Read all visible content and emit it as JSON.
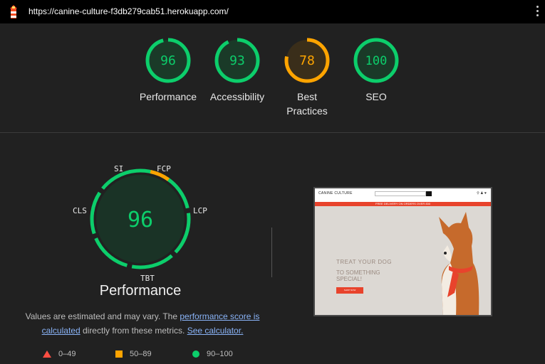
{
  "header": {
    "url": "https://canine-culture-f3db279cab51.herokuapp.com/"
  },
  "colors": {
    "pass": "#0cce6b",
    "average": "#ffa400",
    "fail": "#ff4e42",
    "link": "#8ab4f8"
  },
  "scores": [
    {
      "label": "Performance",
      "value": 96
    },
    {
      "label": "Accessibility",
      "value": 93
    },
    {
      "label": "Best Practices",
      "value": 78
    },
    {
      "label": "SEO",
      "value": 100
    }
  ],
  "performance": {
    "score": "96",
    "title": "Performance",
    "metrics": {
      "si": "SI",
      "fcp": "FCP",
      "lcp": "LCP",
      "tbt": "TBT",
      "cls": "CLS"
    },
    "disclaimer": {
      "text1": "Values are estimated and may vary. The ",
      "link1": "performance score is calculated",
      "text2": " directly from these metrics. ",
      "link2": "See calculator."
    },
    "legend": {
      "fail": "0–49",
      "average": "50–89",
      "pass": "90–100"
    }
  },
  "preview": {
    "brand": "CANINE CULTURE",
    "promo": "FREE DELIVERY ON ORDERS OVER £50",
    "hero_line1": "TREAT YOUR DOG",
    "hero_line2": "TO SOMETHING",
    "hero_line3": "SPECIAL!",
    "cta": "SHOP NOW"
  }
}
